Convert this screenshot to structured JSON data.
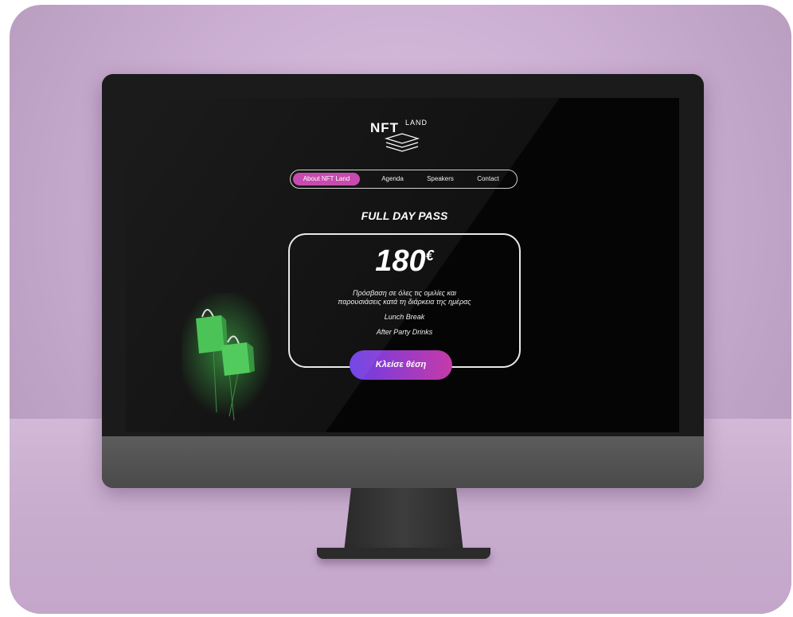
{
  "site": {
    "logo": {
      "main": "NFT",
      "sub": "LAND"
    },
    "nav": {
      "items": [
        {
          "label": "About NFT Land",
          "active": true
        },
        {
          "label": "Agenda",
          "active": false
        },
        {
          "label": "Speakers",
          "active": false
        },
        {
          "label": "Contact",
          "active": false
        }
      ]
    },
    "pass": {
      "title": "FULL DAY PASS",
      "price": "180",
      "currency": "€",
      "features": [
        "Πρόσβαση σε όλες τις ομιλίες και",
        "παρουσιάσεις κατά τη διάρκεια της ημέρας",
        "Lunch Break",
        "After Party Drinks"
      ],
      "cta_label": "Κλείσε θέση"
    }
  },
  "colors": {
    "accent_pink": "#c33ea8",
    "cta_gradient_start": "#6a3de6",
    "cta_gradient_end": "#c63aa8",
    "background_lilac": "#cbaed2",
    "bag_green": "#3fbf4a"
  },
  "icons": [
    "shopping-bag-icon",
    "shopping-bag-icon"
  ]
}
